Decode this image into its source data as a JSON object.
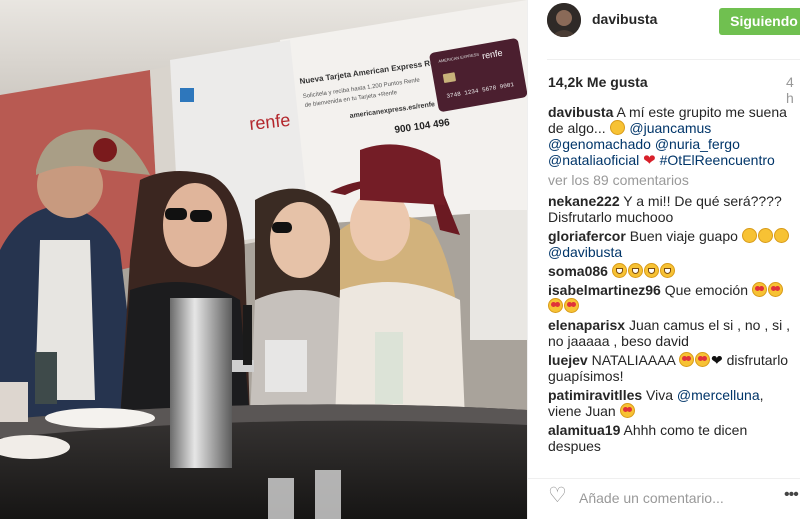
{
  "header": {
    "username": "davibusta",
    "follow_label": "Siguiendo"
  },
  "post": {
    "likes": "14,2k Me gusta",
    "time": "4 h"
  },
  "photo": {
    "ad_title": "Nueva Tarjeta American Express Renfe",
    "ad_line1": "Solicítela y reciba hasta 1.200 Puntos Renfe",
    "ad_line2": "de bienvenida en tu Tarjeta +Renfe",
    "ad_site": "americanexpress.es/renfe",
    "ad_phone": "900 104 496",
    "ad_brand": "renfe",
    "card_brand": "renfe",
    "card_issuer": "AMERICAN EXPRESS",
    "card_number": "3748 1234 5678 9001"
  },
  "caption": {
    "user": "davibusta",
    "text": "A mí este grupito me suena de algo...",
    "mentions": [
      "@juancamus",
      "@genomachado",
      "@nuria_fergo",
      "@nataliaoficial"
    ],
    "hashtag": "#OtElReencuentro"
  },
  "view_more": "ver los 89 comentarios",
  "comments": [
    {
      "user": "nekane222",
      "text": "Y a mi!! De qué será???? Disfrutarlo muchooo"
    },
    {
      "user": "gloriafercor",
      "text": "Buen viaje guapo",
      "mention": "@davibusta"
    },
    {
      "user": "soma086",
      "text": ""
    },
    {
      "user": "isabelmartinez96",
      "text": "Que emoción"
    },
    {
      "user": "elenaparisx",
      "text": "Juan camus el si , no , si , no jaaaaa , beso david"
    },
    {
      "user": "luejev",
      "text": "NATALIAAAA",
      "text2": "disfrutarlo guapísimos!"
    },
    {
      "user": "patimiravitlles",
      "text": "Viva",
      "mention": "@mercelluna",
      "text2": ", viene Juan"
    },
    {
      "user": "alamitua19",
      "text": "Ahhh como te dicen despues"
    }
  ],
  "add_comment": {
    "placeholder": "Añade un comentario..."
  },
  "icons": {
    "like": "heart-outline-icon",
    "options": "ellipsis-icon"
  },
  "colors": {
    "follow_bg": "#70c050",
    "mention": "#003569"
  }
}
